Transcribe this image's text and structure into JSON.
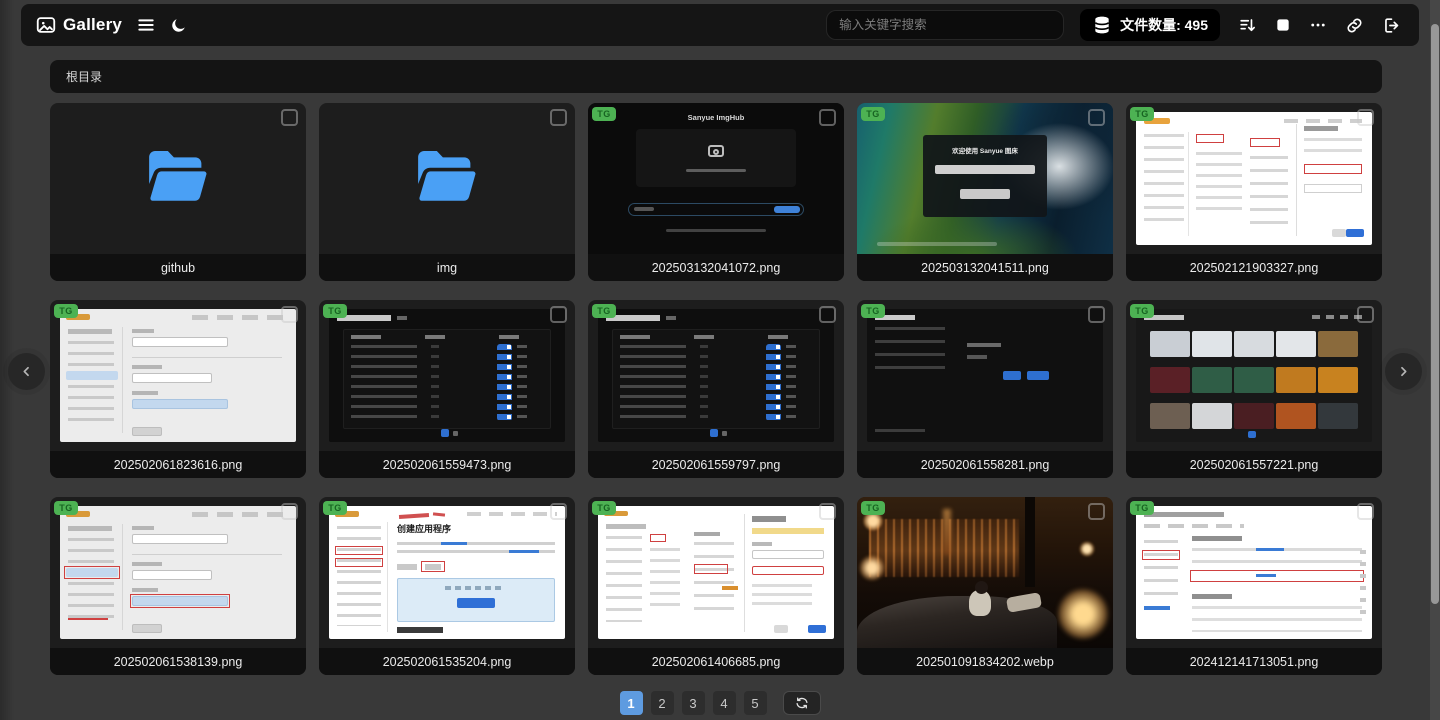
{
  "header": {
    "logo_icon": "gallery-logo-icon",
    "app_title": "Gallery",
    "menu_icon": "menu-icon",
    "theme_icon": "moon-icon",
    "search": {
      "placeholder": "输入关键字搜索",
      "value": ""
    },
    "stats": {
      "icon": "database-icon",
      "label": "文件数量:",
      "value": "495"
    },
    "action_icons": [
      "sort-descending-icon",
      "select-all-icon",
      "more-options-icon",
      "copy-link-icon",
      "logout-icon"
    ]
  },
  "breadcrumb": {
    "path": "根目录"
  },
  "grid": {
    "cards": [
      {
        "name": "github",
        "type": "folder",
        "badge": null,
        "thumb_style": "folder"
      },
      {
        "name": "img",
        "type": "folder",
        "badge": null,
        "thumb_style": "folder"
      },
      {
        "name": "202503132041072.png",
        "type": "image",
        "badge": "TG",
        "thumb_style": "imghub-upload",
        "thumb_text": "Sanyue ImgHub"
      },
      {
        "name": "202503132041511.png",
        "type": "image",
        "badge": "TG",
        "thumb_style": "nature-login",
        "thumb_text": "欢迎使用 Sanyue 图床"
      },
      {
        "name": "202502121903327.png",
        "type": "image",
        "badge": "TG",
        "thumb_style": "console-annot"
      },
      {
        "name": "202502061823616.png",
        "type": "image",
        "badge": "TG",
        "thumb_style": "settings-light"
      },
      {
        "name": "202502061559473.png",
        "type": "image",
        "badge": "TG",
        "thumb_style": "toggles-dark"
      },
      {
        "name": "202502061559797.png",
        "type": "image",
        "badge": "TG",
        "thumb_style": "toggles-dark"
      },
      {
        "name": "202502061558281.png",
        "type": "image",
        "badge": "TG",
        "thumb_style": "sparse-dark"
      },
      {
        "name": "202502061557221.png",
        "type": "image",
        "badge": "TG",
        "thumb_style": "gallery-grid"
      },
      {
        "name": "202502061538139.png",
        "type": "image",
        "badge": "TG",
        "thumb_style": "settings-light-annot"
      },
      {
        "name": "202502061535204.png",
        "type": "image",
        "badge": "TG",
        "thumb_style": "doc-create",
        "thumb_text": "创建应用程序"
      },
      {
        "name": "202502061406685.png",
        "type": "image",
        "badge": "TG",
        "thumb_style": "console-annot2"
      },
      {
        "name": "202501091834202.webp",
        "type": "image",
        "badge": "TG",
        "thumb_style": "anime-night"
      },
      {
        "name": "202412141713051.png",
        "type": "image",
        "badge": "TG",
        "thumb_style": "console-annot3"
      }
    ]
  },
  "pagination": {
    "pages": [
      "1",
      "2",
      "3",
      "4",
      "5"
    ],
    "active_page": "1",
    "refresh_icon": "refresh-icon"
  },
  "nav": {
    "prev_icon": "chevron-left-icon",
    "next_icon": "chevron-right-icon"
  },
  "colors": {
    "accent_blue": "#5e9be0",
    "badge_green": "#4db253",
    "folder_blue": "#4aa0f5",
    "toggle_blue": "#2e6fd0"
  }
}
